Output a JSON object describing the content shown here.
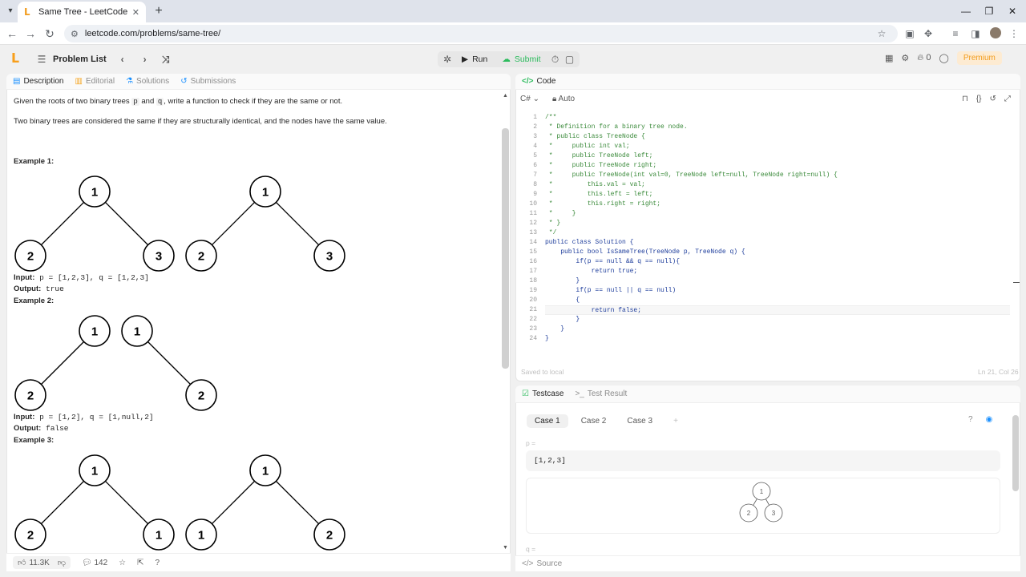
{
  "browser": {
    "tab_title": "Same Tree - LeetCode",
    "url": "leetcode.com/problems/same-tree/"
  },
  "header": {
    "problem_list": "Problem List",
    "run": "Run",
    "submit": "Submit",
    "points": "0",
    "premium": "Premium"
  },
  "left": {
    "tabs": [
      "Description",
      "Editorial",
      "Solutions",
      "Submissions"
    ],
    "desc_line1_pre": "Given the roots of two binary trees ",
    "desc_p": "p",
    "desc_and": " and ",
    "desc_q": "q",
    "desc_line1_post": ", write a function to check if they are the same or not.",
    "desc_line2": "Two binary trees are considered the same if they are structurally identical, and the nodes have the same value.",
    "examples": [
      {
        "title": "Example 1:",
        "input_label": "Input:",
        "input": " p = [1,2,3], q = [1,2,3]",
        "output_label": "Output:",
        "output": " true",
        "tree_a": [
          "1",
          "2",
          "3"
        ],
        "tree_b": [
          "1",
          "2",
          "3"
        ]
      },
      {
        "title": "Example 2:",
        "input_label": "Input:",
        "input": " p = [1,2], q = [1,null,2]",
        "output_label": "Output:",
        "output": " false",
        "tree_a": [
          "1",
          "2"
        ],
        "tree_b": [
          "1",
          "2"
        ]
      },
      {
        "title": "Example 3:",
        "tree_a": [
          "1",
          "2",
          "1"
        ],
        "tree_b": [
          "1",
          "1",
          "2"
        ]
      }
    ],
    "footer": {
      "likes": "11.3K",
      "comments": "142"
    }
  },
  "code": {
    "tab": "Code",
    "language": "C#",
    "mode": "Auto",
    "saved": "Saved to local",
    "cursor": "Ln 21, Col 26",
    "lines": [
      "/**",
      " * Definition for a binary tree node.",
      " * public class TreeNode {",
      " *     public int val;",
      " *     public TreeNode left;",
      " *     public TreeNode right;",
      " *     public TreeNode(int val=0, TreeNode left=null, TreeNode right=null) {",
      " *         this.val = val;",
      " *         this.left = left;",
      " *         this.right = right;",
      " *     }",
      " * }",
      " */",
      "public class Solution {",
      "    public bool IsSameTree(TreeNode p, TreeNode q) {",
      "        if(p == null && q == null){",
      "            return true;",
      "        }",
      "        if(p == null || q == null)",
      "        {",
      "            return false;",
      "        }",
      "    }",
      "}"
    ]
  },
  "test": {
    "tabs": [
      "Testcase",
      "Test Result"
    ],
    "cases": [
      "Case 1",
      "Case 2",
      "Case 3"
    ],
    "add": "+",
    "p_label": "p =",
    "p_value": "[1,2,3]",
    "p_tree": [
      "1",
      "2",
      "3"
    ],
    "q_label": "q =",
    "source": "Source"
  }
}
